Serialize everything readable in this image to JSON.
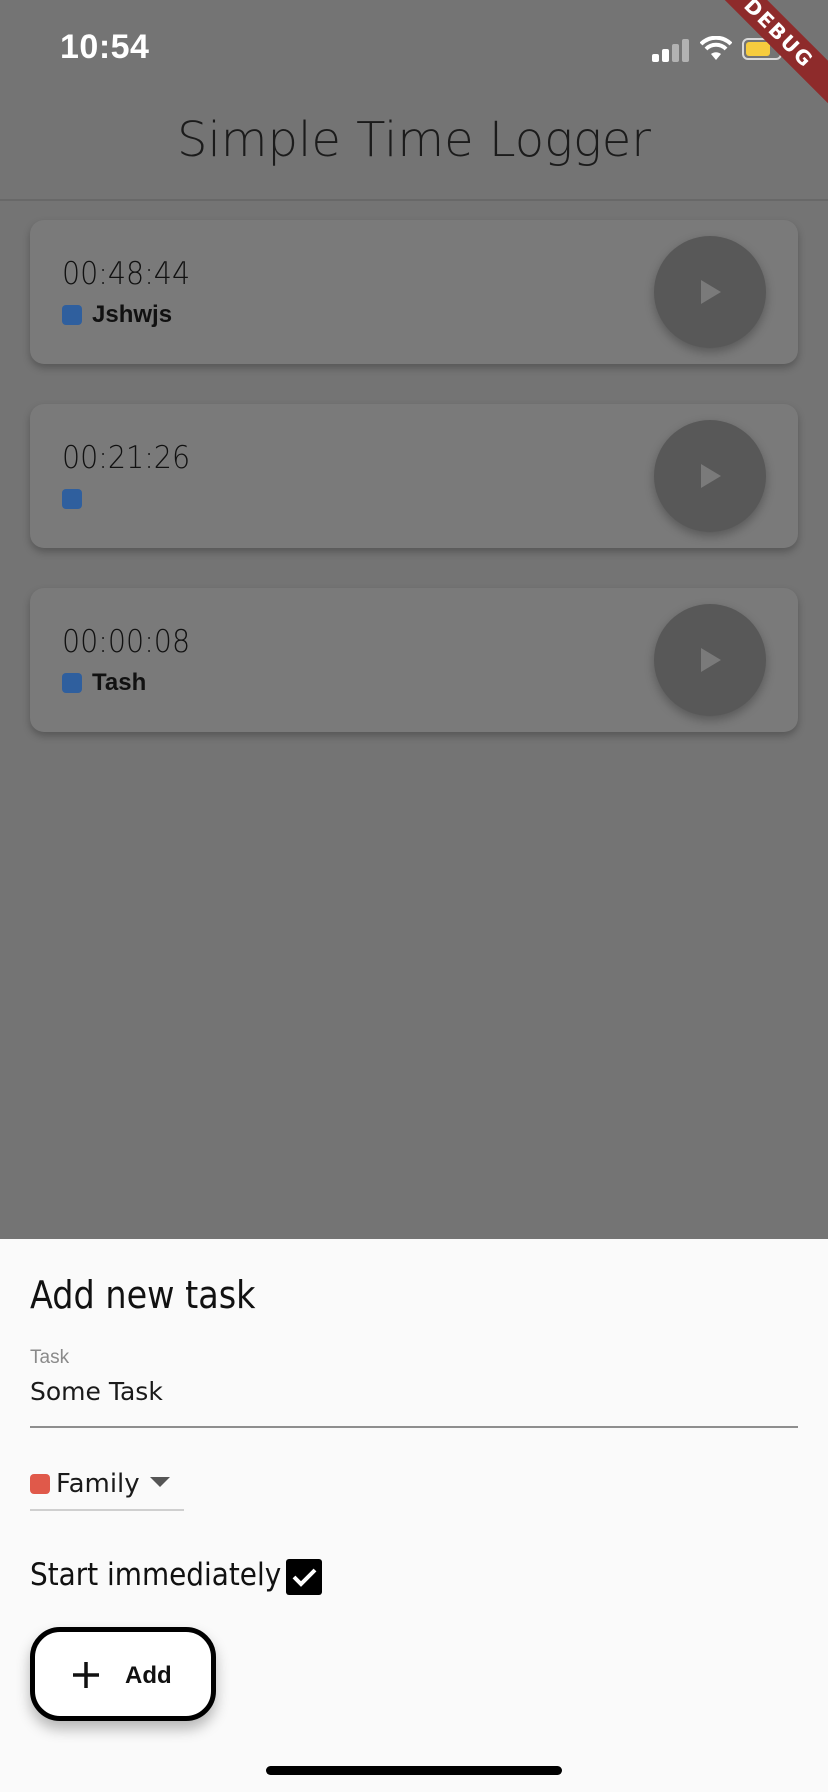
{
  "status_bar": {
    "time": "10:54"
  },
  "debug_banner": "DEBUG",
  "app_bar": {
    "title": "Simple Time Logger"
  },
  "tasks": [
    {
      "duration": "00:48:44",
      "tag_color": "#2f5f9e",
      "label": "Jshwjs"
    },
    {
      "duration": "00:21:26",
      "tag_color": "#2f5f9e",
      "label": ""
    },
    {
      "duration": "00:00:08",
      "tag_color": "#2f5f9e",
      "label": "Tash"
    }
  ],
  "sheet": {
    "title": "Add new task",
    "task_field": {
      "label": "Task",
      "value": "Some Task"
    },
    "category": {
      "selected": "Family",
      "color": "#e0594a"
    },
    "start_immediately": {
      "label": "Start immediately",
      "checked": true
    },
    "add_button_label": "Add"
  },
  "icons": {
    "play": "play-icon",
    "plus": "plus-icon",
    "check": "check-icon",
    "caret": "chevron-down-icon"
  }
}
